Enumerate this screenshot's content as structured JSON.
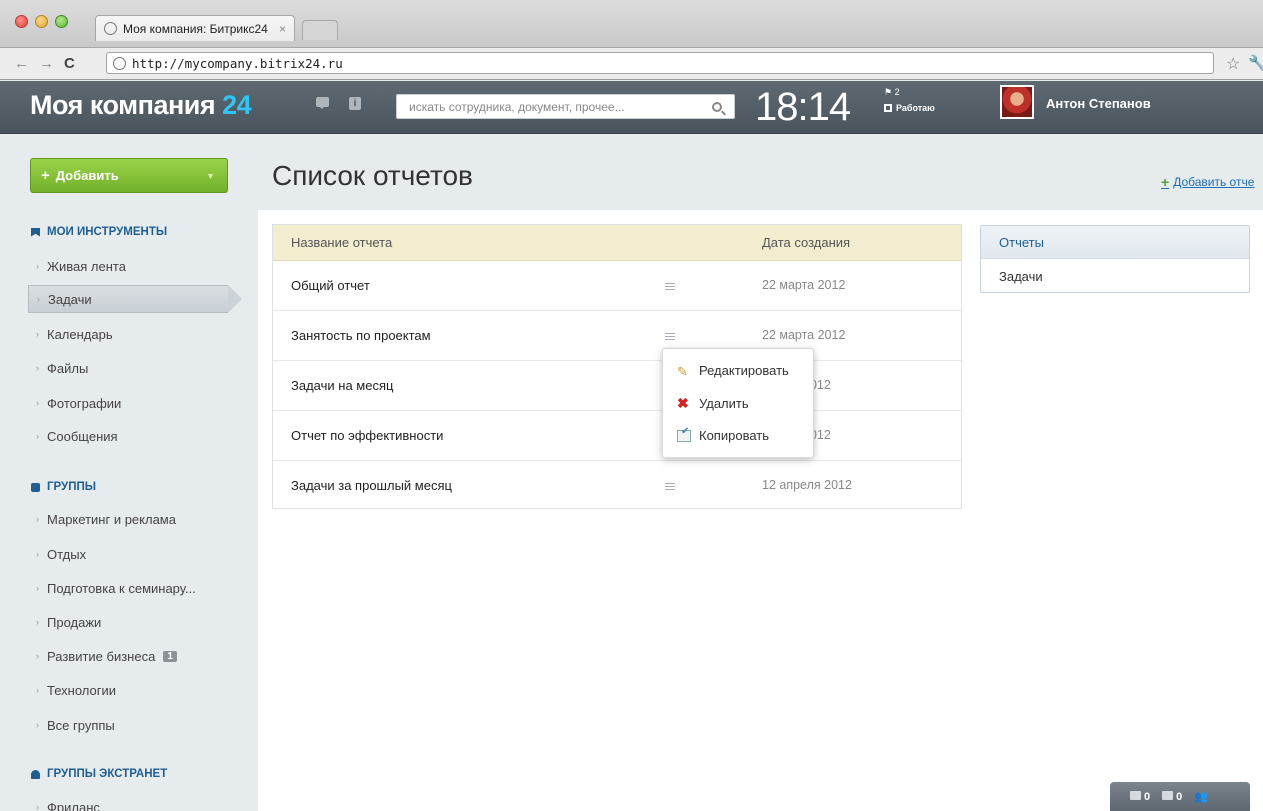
{
  "browser": {
    "tab_title": "Моя компания: Битрикс24",
    "tab_close": "×",
    "url": "http://mycompany.bitrix24.ru"
  },
  "header": {
    "logo_text": "Моя компания",
    "logo_number": "24",
    "search_placeholder": "искать сотрудника, документ, прочее...",
    "clock": "18:14",
    "flag_count": "2",
    "work_status": "Работаю",
    "user_name": "Антон Степанов"
  },
  "sidebar": {
    "add_button": "Добавить",
    "sections": [
      {
        "title": "МОИ ИНСТРУМЕНТЫ",
        "items": [
          "Живая лента",
          "Задачи",
          "Календарь",
          "Файлы",
          "Фотографии",
          "Сообщения"
        ]
      },
      {
        "title": "ГРУППЫ",
        "items": [
          "Маркетинг и реклама",
          "Отдых",
          "Подготовка к семинару...",
          "Продажи",
          "Развитие бизнеса",
          "Технологии",
          "Все группы"
        ]
      },
      {
        "title": "ГРУППЫ ЭКСТРАНЕТ",
        "items": [
          "Фриланс"
        ]
      }
    ],
    "group_counter": "1"
  },
  "main": {
    "page_title": "Список отчетов",
    "add_report_link": "Добавить отче",
    "table": {
      "headers": [
        "Название отчета",
        "Дата создания"
      ],
      "rows": [
        {
          "name": "Общий отчет",
          "date": "22 марта 2012"
        },
        {
          "name": "Занятость по проектам",
          "date": "22 марта 2012"
        },
        {
          "name": "Задачи на месяц",
          "date": "2012"
        },
        {
          "name": "Отчет по эффективности",
          "date": "2012"
        },
        {
          "name": "Задачи за прошлый месяц",
          "date": "12 апреля 2012"
        }
      ]
    },
    "context_menu": [
      "Редактировать",
      "Удалить",
      "Копировать"
    ],
    "right_panel": [
      "Отчеты",
      "Задачи"
    ]
  },
  "bottom_bar": {
    "messages": "0",
    "notifications": "0"
  }
}
